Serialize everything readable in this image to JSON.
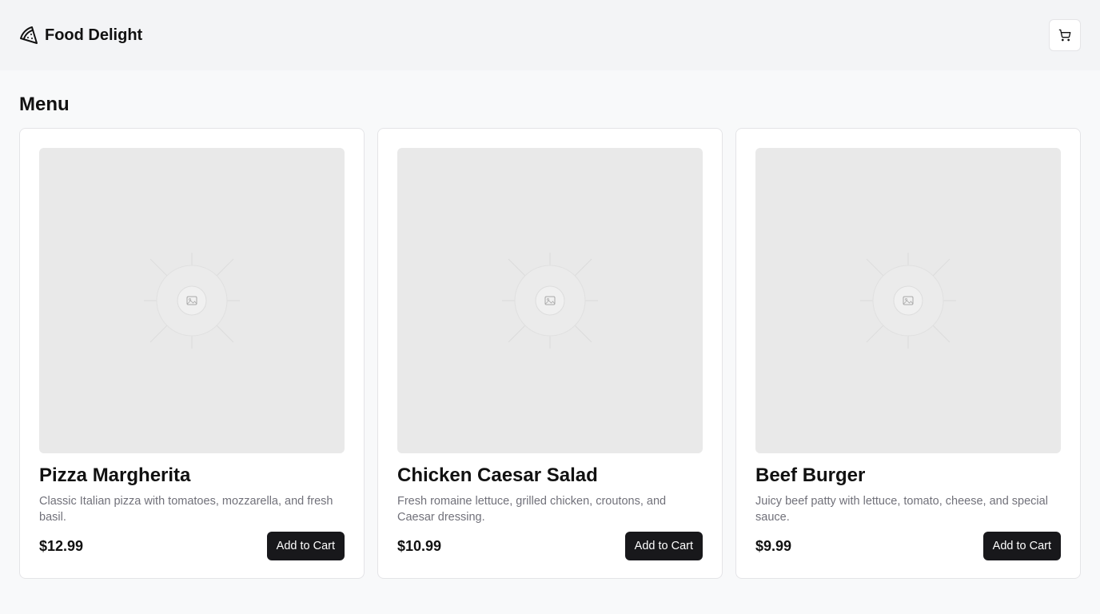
{
  "header": {
    "brand_name": "Food Delight",
    "brand_icon": "pizza-slice-icon",
    "cart_icon": "shopping-cart-icon"
  },
  "main": {
    "title": "Menu",
    "items": [
      {
        "name": "Pizza Margherita",
        "description": "Classic Italian pizza with tomatoes, mozzarella, and fresh basil.",
        "price": "$12.99",
        "button_label": "Add to Cart",
        "image_icon": "image-placeholder-icon"
      },
      {
        "name": "Chicken Caesar Salad",
        "description": "Fresh romaine lettuce, grilled chicken, croutons, and Caesar dressing.",
        "price": "$10.99",
        "button_label": "Add to Cart",
        "image_icon": "image-placeholder-icon"
      },
      {
        "name": "Beef Burger",
        "description": "Juicy beef patty with lettuce, tomato, cheese, and special sauce.",
        "price": "$9.99",
        "button_label": "Add to Cart",
        "image_icon": "image-placeholder-icon"
      }
    ]
  },
  "colors": {
    "background": "#f8f9fa",
    "header_background": "#f3f4f6",
    "button_background": "#18181b",
    "muted_text": "#71717a",
    "placeholder_background": "#e9e9e9"
  }
}
